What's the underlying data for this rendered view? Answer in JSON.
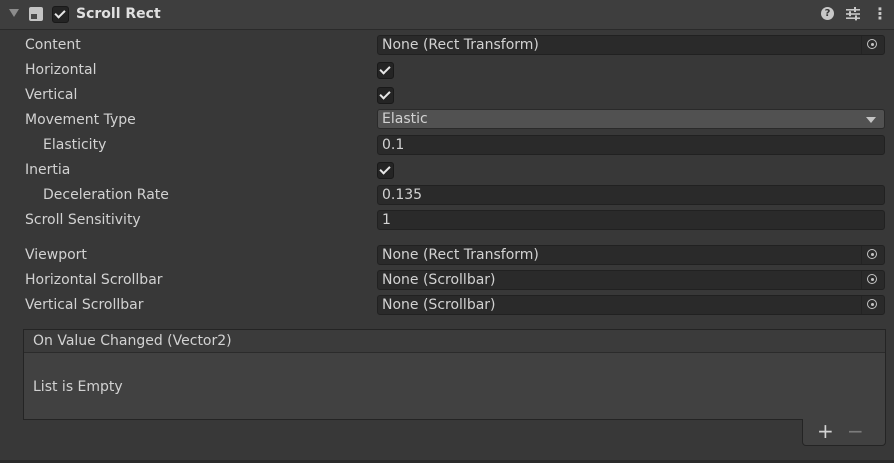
{
  "component": {
    "title": "Scroll Rect",
    "enabled": true,
    "help_glyph": "?",
    "more_glyph": "⋮"
  },
  "properties": {
    "content": {
      "label": "Content",
      "value": "None (Rect Transform)"
    },
    "horizontal": {
      "label": "Horizontal",
      "checked": true
    },
    "vertical": {
      "label": "Vertical",
      "checked": true
    },
    "movement_type": {
      "label": "Movement Type",
      "value": "Elastic"
    },
    "elasticity": {
      "label": "Elasticity",
      "value": "0.1"
    },
    "inertia": {
      "label": "Inertia",
      "checked": true
    },
    "deceleration_rate": {
      "label": "Deceleration Rate",
      "value": "0.135"
    },
    "scroll_sensitivity": {
      "label": "Scroll Sensitivity",
      "value": "1"
    },
    "viewport": {
      "label": "Viewport",
      "value": "None (Rect Transform)"
    },
    "horizontal_scrollbar": {
      "label": "Horizontal Scrollbar",
      "value": "None (Scrollbar)"
    },
    "vertical_scrollbar": {
      "label": "Vertical Scrollbar",
      "value": "None (Scrollbar)"
    }
  },
  "event": {
    "title": "On Value Changed (Vector2)",
    "empty_text": "List is Empty",
    "add_glyph": "+",
    "remove_glyph": "−"
  },
  "icons": {
    "foldout": "triangle-down-icon",
    "component": "scroll-rect-component-icon",
    "help": "help-icon",
    "presets": "presets-icon",
    "more": "kebab-menu-icon",
    "object_picker": "object-picker-icon"
  },
  "colors": {
    "background": "#383838",
    "header": "#3e3e3e",
    "field": "#2a2a2a",
    "dropdown": "#515151",
    "text": "#d2d2d2"
  }
}
